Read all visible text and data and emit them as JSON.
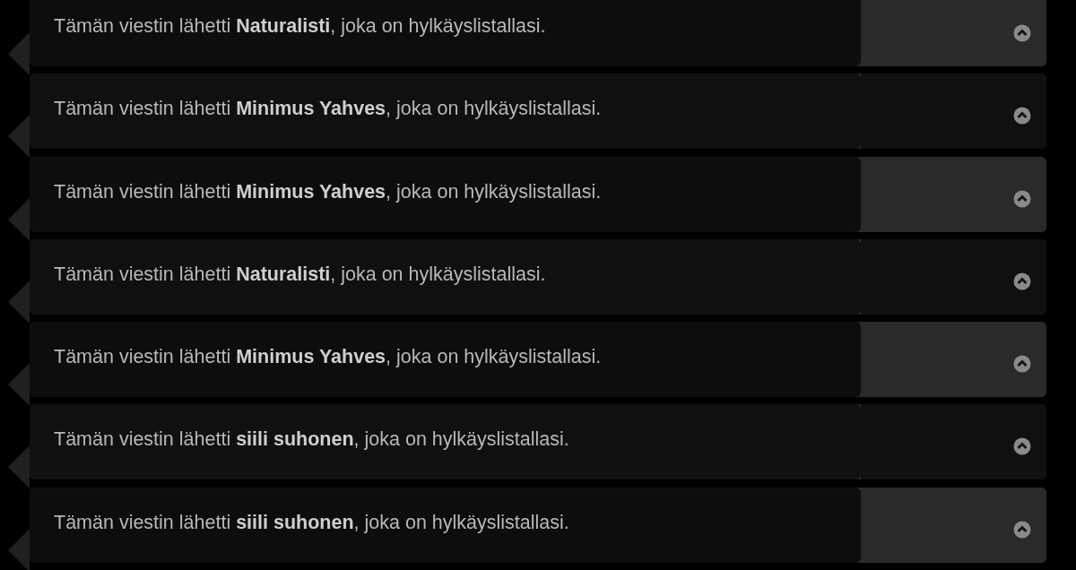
{
  "posts": [
    {
      "message": "Tämän viestin lähetti **Naturalisti**, joka on hylkäyslistallasi.",
      "shaded_side": true
    },
    {
      "message": "Tämän viestin lähetti **Minimus Yahves**, joka on hylkäyslistallasi.",
      "shaded_side": false
    },
    {
      "message": "Tämän viestin lähetti **Minimus Yahves**, joka on hylkäyslistallasi.",
      "shaded_side": true
    },
    {
      "message": "Tämän viestin lähetti **Naturalisti**, joka on hylkäyslistallasi.",
      "shaded_side": false
    },
    {
      "message": "Tämän viestin lähetti **Minimus Yahves**, joka on hylkäyslistallasi.",
      "shaded_side": true
    },
    {
      "message": "Tämän viestin lähetti **siili suhonen**, joka on hylkäyslistallasi.",
      "shaded_side": false
    },
    {
      "message": "Tämän viestin lähetti **siili suhonen**, joka on hylkäyslistallasi.",
      "shaded_side": true
    }
  ]
}
